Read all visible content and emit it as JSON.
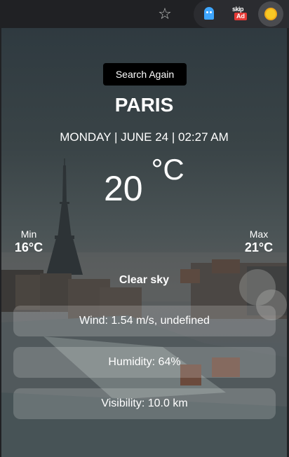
{
  "browser": {
    "extensions": [
      {
        "name": "ghost-extension",
        "icon": "ghost-icon"
      },
      {
        "name": "skip-ad-extension",
        "icon": "skip-ad-icon",
        "top_text": "skip",
        "badge_text": "Ad"
      },
      {
        "name": "weather-extension",
        "icon": "sun-icon"
      }
    ],
    "bookmark_icon": "star-icon"
  },
  "weather": {
    "search_label": "Search Again",
    "city": "PARIS",
    "datetime": "MONDAY | JUNE 24 | 02:27 AM",
    "temp_value": "20",
    "temp_unit": "°C",
    "min_label": "Min",
    "min_value": "16°C",
    "max_label": "Max",
    "max_value": "21°C",
    "description": "Clear sky",
    "wind": "Wind: 1.54 m/s, undefined",
    "humidity": "Humidity: 64%",
    "visibility": "Visibility: 10.0 km"
  },
  "colors": {
    "toolbar_bg": "#202124",
    "button_bg": "#000000",
    "text": "#ffffff",
    "card_bg": "rgba(255,255,255,0.18)"
  }
}
